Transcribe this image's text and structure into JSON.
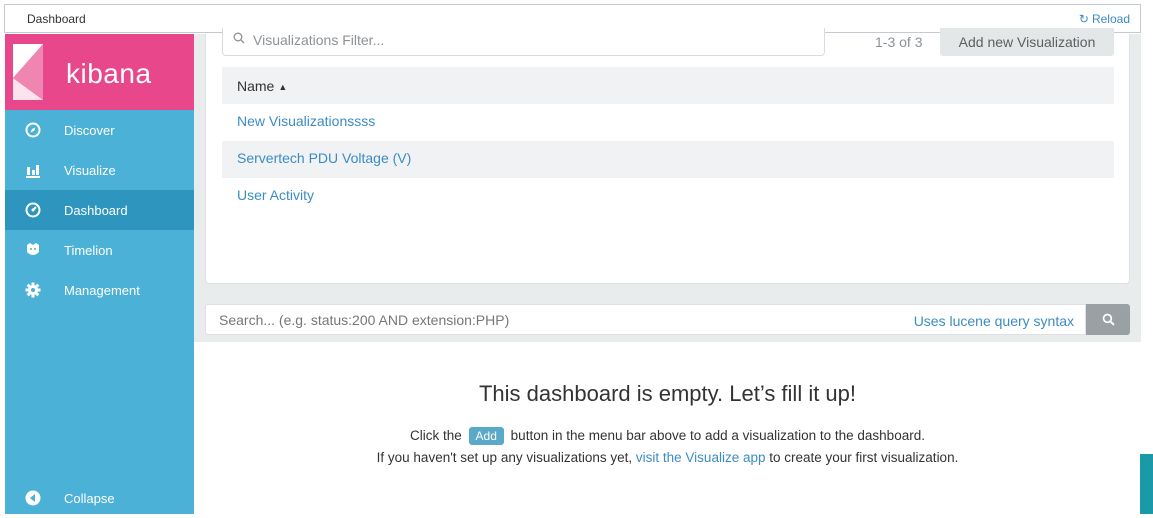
{
  "titlebar": {
    "title": "Dashboard",
    "reload_label": "Reload"
  },
  "brand": {
    "name": "kibana",
    "color": "#e8488b"
  },
  "sidebar": {
    "items": [
      {
        "label": "Discover",
        "icon": "compass-icon"
      },
      {
        "label": "Visualize",
        "icon": "bar-chart-icon"
      },
      {
        "label": "Dashboard",
        "icon": "dashboard-icon",
        "active": true
      },
      {
        "label": "Timelion",
        "icon": "timelion-icon"
      },
      {
        "label": "Management",
        "icon": "gear-icon"
      }
    ],
    "collapse_label": "Collapse",
    "bg_color": "#4cb1d6",
    "active_color": "#2e95be"
  },
  "picker": {
    "filter_placeholder": "Visualizations Filter...",
    "pager": "1-3 of 3",
    "add_label": "Add new Visualization",
    "column_name": "Name",
    "rows": [
      "New Visualizationssss",
      "Servertech PDU Voltage (V)",
      "User Activity"
    ]
  },
  "query": {
    "placeholder": "Search... (e.g. status:200 AND extension:PHP)",
    "syntax_link": "Uses lucene query syntax"
  },
  "empty": {
    "title": "This dashboard is empty. Let’s fill it up!",
    "line1_pre": "Click the",
    "add_label": "Add",
    "line1_post": "button in the menu bar above to add a visualization to the dashboard.",
    "line2_pre": "If you haven't set up any visualizations yet,",
    "line2_link": "visit the Visualize app",
    "line2_post": "to create your first visualization."
  }
}
